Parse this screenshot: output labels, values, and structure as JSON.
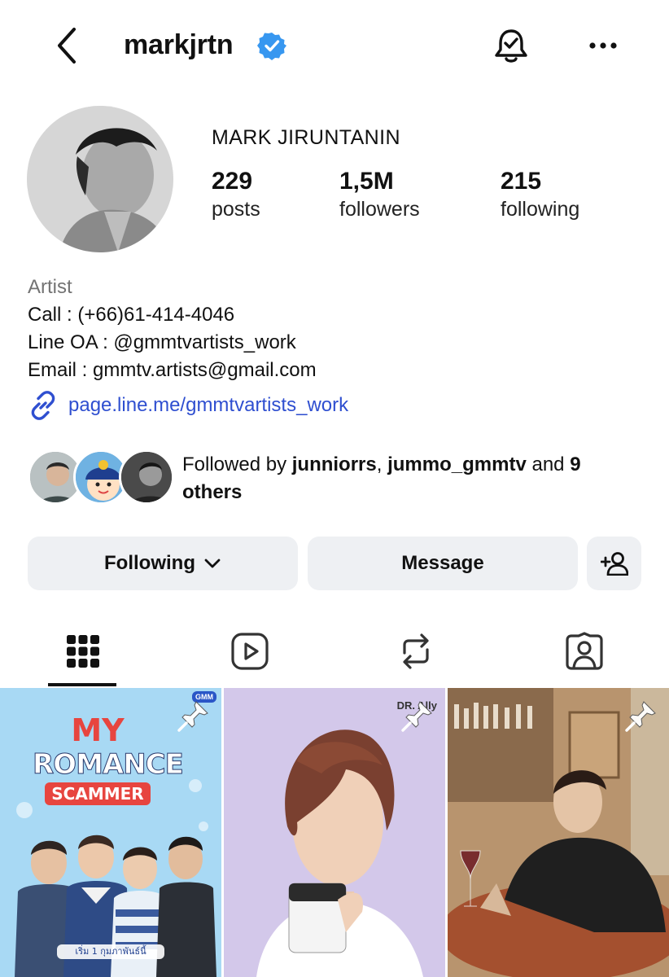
{
  "header": {
    "username": "markjrtn",
    "verified_icon": "verified-badge-icon",
    "back_icon": "chevron-left-icon",
    "bell_icon": "bell-check-icon",
    "more_icon": "more-horizontal-icon"
  },
  "profile": {
    "display_name": "MARK JIRUNTANIN",
    "stats": {
      "posts": {
        "value": "229",
        "label": "posts"
      },
      "followers": {
        "value": "1,5M",
        "label": "followers"
      },
      "following": {
        "value": "215",
        "label": "following"
      }
    },
    "bio": {
      "category": "Artist",
      "lines": [
        "Call : (+66)61-414-4046",
        "Line OA : @gmmtvartists_work",
        "Email : gmmtv.artists@gmail.com"
      ],
      "link": "page.line.me/gmmtvartists_work"
    },
    "followed_by": {
      "prefix": "Followed by ",
      "user1": "junniorrs",
      "separator": ", ",
      "user2": "jummo_gmmtv",
      "and": " and ",
      "others": "9 others"
    }
  },
  "actions": {
    "following_label": "Following",
    "message_label": "Message"
  },
  "tabs": [
    "grid-icon",
    "reels-icon",
    "reposts-icon",
    "tagged-icon"
  ],
  "posts": {
    "post1": {
      "title_my": "MY",
      "title_romance": "ROMANCE",
      "title_scammer": "SCAMMER",
      "corner_tag": "GMM",
      "bottom_text": "เริ่ม 1 กุมภาพันธ์นี้"
    },
    "post2": {
      "brand_tag": "DR. Ally"
    }
  },
  "colors": {
    "link_blue": "#2f4fd0",
    "verified_blue": "#3797f0",
    "button_bg": "#eef0f3",
    "muted_text": "#737373"
  }
}
